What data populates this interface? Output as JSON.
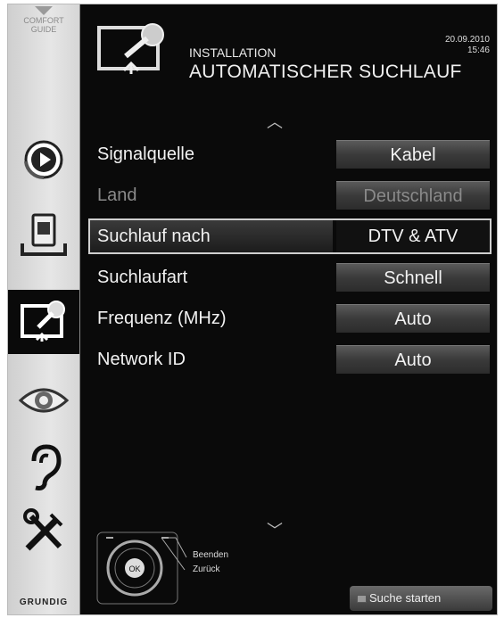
{
  "sidebar": {
    "comfort_guide": "COMFORT\nGUIDE",
    "items": [
      {
        "name": "playback"
      },
      {
        "name": "source"
      },
      {
        "name": "installation"
      },
      {
        "name": "picture"
      },
      {
        "name": "sound"
      },
      {
        "name": "settings"
      }
    ],
    "brand": "GRUNDIG"
  },
  "header": {
    "subtitle": "INSTALLATION",
    "title": "AUTOMATISCHER SUCHLAUF",
    "date": "20.09.2010",
    "time": "15:46"
  },
  "menu": [
    {
      "label": "Signalquelle",
      "value": "Kabel",
      "state": "normal"
    },
    {
      "label": "Land",
      "value": "Deutschland",
      "state": "dim"
    },
    {
      "label": "Suchlauf nach",
      "value": "DTV & ATV",
      "state": "selected"
    },
    {
      "label": "Suchlaufart",
      "value": "Schnell",
      "state": "normal"
    },
    {
      "label": "Frequenz (MHz)",
      "value": "Auto",
      "state": "normal"
    },
    {
      "label": "Network ID",
      "value": "Auto",
      "state": "normal"
    }
  ],
  "footer": {
    "ok_label": "OK",
    "exit_label": "Beenden",
    "back_label": "Zurück",
    "search_button": "Suche starten"
  }
}
